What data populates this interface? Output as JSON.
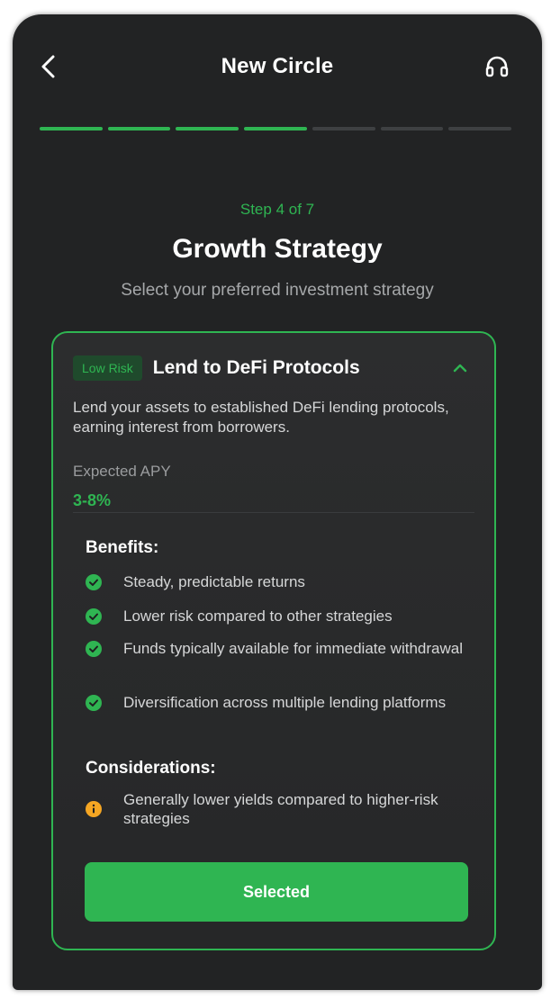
{
  "header": {
    "title": "New Circle",
    "back_icon": "chevron-left-icon",
    "support_icon": "headset-icon"
  },
  "progress": {
    "total_steps": 7,
    "completed_steps": 4
  },
  "step": {
    "label": "Step 4 of 7"
  },
  "page": {
    "heading": "Growth Strategy",
    "subheading": "Select your preferred investment strategy"
  },
  "strategy": {
    "risk_badge": "Low Risk",
    "title": "Lend to DeFi Protocols",
    "description": "Lend your assets to established DeFi lending protocols, earning interest from borrowers.",
    "apy_label": "Expected APY",
    "apy_value": "3-8%",
    "benefits_title": "Benefits:",
    "benefits": [
      "Steady, predictable returns",
      "Lower risk compared to other strategies",
      "Funds typically available for immediate withdrawal",
      "Diversification across multiple lending platforms"
    ],
    "considerations_title": "Considerations:",
    "considerations": [
      "Generally lower yields compared to higher-risk strategies"
    ],
    "button_label": "Selected"
  },
  "colors": {
    "accent": "#2fb552",
    "background": "#222324",
    "warning": "#f5a623"
  }
}
